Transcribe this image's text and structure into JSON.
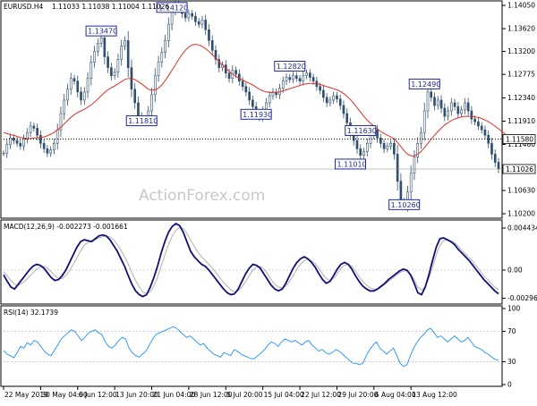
{
  "header": {
    "symbol": "EURUSD.H4",
    "ohlc": "1.11033 1.11038 1.11004 1.11026"
  },
  "watermark": "ActionForex.com",
  "chart_data": [
    {
      "type": "line",
      "pane": "price",
      "series_kind": "candlestick",
      "y_ticks": [
        "1.14050",
        "1.13620",
        "1.13200",
        "1.12775",
        "1.12340",
        "1.11910",
        "1.11480",
        "1.11050",
        "1.10630",
        "1.10200"
      ],
      "y_tick_values": [
        1.1405,
        1.1362,
        1.132,
        1.12775,
        1.1234,
        1.1191,
        1.1148,
        1.1105,
        1.1063,
        1.102
      ],
      "ylim": [
        1.1015,
        1.141
      ],
      "colors": {
        "candles": "#2f4f6f",
        "ma": "#e0302a",
        "dotted": "#000000"
      },
      "close_series": [
        1.1132,
        1.1148,
        1.116,
        1.1155,
        1.115,
        1.1145,
        1.1158,
        1.117,
        1.1182,
        1.1178,
        1.1165,
        1.115,
        1.114,
        1.1132,
        1.1138,
        1.115,
        1.1175,
        1.1205,
        1.123,
        1.125,
        1.127,
        1.1265,
        1.1245,
        1.123,
        1.1245,
        1.127,
        1.13,
        1.132,
        1.1335,
        1.1345,
        1.131,
        1.129,
        1.1275,
        1.1282,
        1.1305,
        1.133,
        1.134,
        1.129,
        1.125,
        1.1225,
        1.12,
        1.119,
        1.1195,
        1.121,
        1.124,
        1.1275,
        1.13,
        1.1318,
        1.134,
        1.137,
        1.1395,
        1.1408,
        1.1402,
        1.139,
        1.1382,
        1.139,
        1.1385,
        1.1375,
        1.137,
        1.1378,
        1.136,
        1.134,
        1.1322,
        1.1305,
        1.129,
        1.1295,
        1.128,
        1.127,
        1.1285,
        1.1278,
        1.1265,
        1.1255,
        1.1245,
        1.123,
        1.1218,
        1.1205,
        1.1198,
        1.121,
        1.1225,
        1.1238,
        1.1245,
        1.124,
        1.1252,
        1.1265,
        1.1272,
        1.1268,
        1.1275,
        1.127,
        1.1265,
        1.1275,
        1.128,
        1.1272,
        1.1265,
        1.1255,
        1.1248,
        1.1235,
        1.1225,
        1.123,
        1.1238,
        1.1232,
        1.122,
        1.1205,
        1.1188,
        1.117,
        1.1155,
        1.114,
        1.1128,
        1.1135,
        1.115,
        1.1165,
        1.1175,
        1.116,
        1.115,
        1.114,
        1.1145,
        1.115,
        1.113,
        1.108,
        1.1042,
        1.1035,
        1.106,
        1.1095,
        1.1125,
        1.115,
        1.117,
        1.121,
        1.1245,
        1.1235,
        1.122,
        1.123,
        1.1215,
        1.12,
        1.121,
        1.1225,
        1.1218,
        1.1205,
        1.1212,
        1.1225,
        1.121,
        1.1195,
        1.119,
        1.1182,
        1.1175,
        1.1165,
        1.115,
        1.113,
        1.1115,
        1.1103
      ],
      "ma_series": [
        1.117,
        1.1168,
        1.1166,
        1.1165,
        1.1163,
        1.1161,
        1.116,
        1.1159,
        1.1159,
        1.116,
        1.1161,
        1.1161,
        1.1162,
        1.1164,
        1.1167,
        1.117,
        1.1175,
        1.118,
        1.1186,
        1.1192,
        1.1198,
        1.1203,
        1.1207,
        1.121,
        1.1213,
        1.1217,
        1.1221,
        1.1226,
        1.1232,
        1.1238,
        1.1244,
        1.1249,
        1.1253,
        1.1256,
        1.126,
        1.1264,
        1.1268,
        1.127,
        1.127,
        1.1268,
        1.1264,
        1.126,
        1.1255,
        1.125,
        1.1248,
        1.1249,
        1.1252,
        1.1258,
        1.1266,
        1.1275,
        1.1285,
        1.1295,
        1.1305,
        1.1314,
        1.1322,
        1.1328,
        1.1332,
        1.1333,
        1.1332,
        1.1329,
        1.1325,
        1.132,
        1.1314,
        1.1308,
        1.1301,
        1.1295,
        1.1289,
        1.1283,
        1.1278,
        1.1274,
        1.127,
        1.1267,
        1.1264,
        1.1261,
        1.1258,
        1.1254,
        1.125,
        1.1247,
        1.1245,
        1.1244,
        1.1244,
        1.1244,
        1.1245,
        1.1247,
        1.1249,
        1.1251,
        1.1253,
        1.1255,
        1.1257,
        1.1259,
        1.126,
        1.1261,
        1.1261,
        1.126,
        1.1259,
        1.1257,
        1.1255,
        1.1253,
        1.1251,
        1.1249,
        1.1246,
        1.1242,
        1.1237,
        1.1231,
        1.1224,
        1.1216,
        1.1208,
        1.12,
        1.1193,
        1.1187,
        1.1182,
        1.1177,
        1.1172,
        1.1168,
        1.1165,
        1.1162,
        1.1158,
        1.1152,
        1.1144,
        1.1136,
        1.113,
        1.1127,
        1.1127,
        1.113,
        1.1135,
        1.1142,
        1.115,
        1.1158,
        1.1165,
        1.1172,
        1.1178,
        1.1184,
        1.1188,
        1.1192,
        1.1195,
        1.1197,
        1.1199,
        1.12,
        1.12,
        1.12,
        1.1199,
        1.1198,
        1.1196,
        1.1193,
        1.119,
        1.1186,
        1.1182,
        1.1177,
        1.1172,
        1.1167
      ],
      "dotted_level": 1.1158,
      "current_price": 1.11026,
      "axis_tags": [
        {
          "label": "1.11580",
          "value": 1.1158,
          "bg": "#ffffff",
          "fg": "#000000"
        },
        {
          "label": "1.11026",
          "value": 1.11026,
          "bg": "#ffffff",
          "fg": "#000000"
        }
      ],
      "annotations": [
        {
          "label": "1.13470",
          "index": 29,
          "value": 1.1347
        },
        {
          "label": "1.14120",
          "index": 50,
          "value": 1.1412
        },
        {
          "label": "1.11810",
          "index": 41,
          "value": 1.1181
        },
        {
          "label": "1.11930",
          "index": 75,
          "value": 1.1193
        },
        {
          "label": "1.12820",
          "index": 85,
          "value": 1.1282
        },
        {
          "label": "1.11630",
          "index": 106,
          "value": 1.1163
        },
        {
          "label": "1.11010",
          "index": 103,
          "value": 1.1101
        },
        {
          "label": "1.10260",
          "index": 119,
          "value": 1.1026
        },
        {
          "label": "1.12490",
          "index": 125,
          "value": 1.1249
        }
      ]
    },
    {
      "type": "line",
      "pane": "macd",
      "title": "MACD(12,26,9) -0.002273 -0.001661",
      "y_ticks": [
        "0.004434",
        "0.00",
        "-0.002969"
      ],
      "y_tick_values": [
        0.004434,
        0.0,
        -0.002969
      ],
      "ylim": [
        -0.0034,
        0.005
      ],
      "colors": {
        "macd": "#10107a",
        "signal": "#b0b0b0"
      },
      "macd_series": [
        -0.0005,
        -0.0012,
        -0.0018,
        -0.002,
        -0.0015,
        -0.001,
        -0.0005,
        0.0,
        0.0004,
        0.0006,
        0.0005,
        0.0002,
        -0.0003,
        -0.0008,
        -0.0011,
        -0.001,
        -0.0006,
        0.0,
        0.0008,
        0.0016,
        0.0024,
        0.003,
        0.0032,
        0.0031,
        0.003,
        0.0033,
        0.0036,
        0.0037,
        0.0036,
        0.0032,
        0.0026,
        0.002,
        0.0012,
        0.0004,
        -0.0006,
        -0.0015,
        -0.0022,
        -0.0026,
        -0.0028,
        -0.0026,
        -0.0018,
        -0.0008,
        0.0004,
        0.0018,
        0.003,
        0.004,
        0.0046,
        0.0049,
        0.0047,
        0.004,
        0.003,
        0.002,
        0.0014,
        0.001,
        0.0006,
        0.0004,
        0.0,
        -0.0005,
        -0.001,
        -0.0015,
        -0.002,
        -0.0024,
        -0.0026,
        -0.0025,
        -0.002,
        -0.0012,
        -0.0004,
        0.0002,
        0.0006,
        0.0005,
        0.0002,
        -0.0004,
        -0.001,
        -0.0016,
        -0.002,
        -0.0022,
        -0.002,
        -0.0014,
        -0.0006,
        0.0002,
        0.0008,
        0.0012,
        0.0014,
        0.0012,
        0.0008,
        0.0003,
        -0.0004,
        -0.001,
        -0.0014,
        -0.0012,
        -0.0006,
        0.0001,
        0.0006,
        0.0008,
        0.0006,
        0.0001,
        -0.0006,
        -0.0012,
        -0.0017,
        -0.002,
        -0.0022,
        -0.0022,
        -0.002,
        -0.0017,
        -0.0014,
        -0.001,
        -0.0007,
        -0.0004,
        -0.0001,
        0.0001,
        0.0,
        -0.0005,
        -0.0014,
        -0.0024,
        -0.0026,
        -0.0018,
        -0.0005,
        0.001,
        0.0024,
        0.0033,
        0.0034,
        0.0032,
        0.003,
        0.0027,
        0.0022,
        0.0018,
        0.0014,
        0.001,
        0.0005,
        0.0,
        -0.0005,
        -0.001,
        -0.0014,
        -0.0018,
        -0.0022,
        -0.0025
      ],
      "signal_series": [
        -0.0002,
        -0.0006,
        -0.0011,
        -0.0015,
        -0.0016,
        -0.0014,
        -0.0011,
        -0.0007,
        -0.0003,
        0.0001,
        0.0003,
        0.0004,
        0.0002,
        -0.0002,
        -0.0006,
        -0.0009,
        -0.0009,
        -0.0006,
        -0.0001,
        0.0006,
        0.0013,
        0.002,
        0.0026,
        0.0029,
        0.0031,
        0.0032,
        0.0034,
        0.0035,
        0.0036,
        0.0035,
        0.0032,
        0.0027,
        0.0021,
        0.0014,
        0.0006,
        -0.0003,
        -0.0011,
        -0.0018,
        -0.0023,
        -0.0025,
        -0.0023,
        -0.0017,
        -0.0008,
        0.0004,
        0.0016,
        0.0027,
        0.0036,
        0.0042,
        0.0045,
        0.0044,
        0.0039,
        0.0032,
        0.0025,
        0.0019,
        0.0014,
        0.001,
        0.0006,
        0.0002,
        -0.0003,
        -0.0008,
        -0.0013,
        -0.0017,
        -0.0021,
        -0.0023,
        -0.0022,
        -0.0018,
        -0.0012,
        -0.0006,
        0.0,
        0.0003,
        0.0004,
        0.0001,
        -0.0004,
        -0.001,
        -0.0015,
        -0.0018,
        -0.0019,
        -0.0017,
        -0.0012,
        -0.0006,
        0.0001,
        0.0006,
        0.001,
        0.0011,
        0.001,
        0.0007,
        0.0002,
        -0.0004,
        -0.0009,
        -0.0011,
        -0.0009,
        -0.0004,
        0.0002,
        0.0005,
        0.0006,
        0.0004,
        -0.0001,
        -0.0007,
        -0.0012,
        -0.0016,
        -0.0019,
        -0.002,
        -0.002,
        -0.0018,
        -0.0015,
        -0.0012,
        -0.0009,
        -0.0006,
        -0.0003,
        -0.0001,
        -0.0001,
        -0.0004,
        -0.001,
        -0.0018,
        -0.0021,
        -0.0018,
        -0.0009,
        0.0003,
        0.0016,
        0.0026,
        0.0031,
        0.0032,
        0.0031,
        0.0029,
        0.0025,
        0.0021,
        0.0017,
        0.0013,
        0.0009,
        0.0004,
        -0.0001,
        -0.0006,
        -0.001,
        -0.0014,
        -0.0018,
        -0.0021
      ]
    },
    {
      "type": "line",
      "pane": "rsi",
      "title": "RSI(14) 32.1739",
      "y_ticks": [
        "100",
        "70",
        "30",
        "0"
      ],
      "y_tick_values": [
        100,
        70,
        30,
        0
      ],
      "ylim": [
        0,
        100
      ],
      "levels": [
        70,
        30
      ],
      "colors": {
        "rsi": "#1e90ff",
        "levels": "#999999"
      },
      "rsi_series": [
        45,
        40,
        38,
        35,
        42,
        50,
        48,
        55,
        52,
        58,
        56,
        50,
        44,
        40,
        38,
        45,
        52,
        60,
        64,
        68,
        72,
        70,
        64,
        58,
        62,
        68,
        70,
        72,
        68,
        66,
        56,
        50,
        48,
        52,
        58,
        62,
        60,
        48,
        42,
        38,
        36,
        40,
        44,
        52,
        60,
        66,
        68,
        70,
        72,
        74,
        76,
        74,
        70,
        66,
        62,
        64,
        60,
        56,
        52,
        54,
        48,
        44,
        40,
        38,
        36,
        42,
        40,
        38,
        46,
        44,
        40,
        38,
        36,
        34,
        34,
        38,
        42,
        46,
        52,
        56,
        54,
        50,
        56,
        60,
        58,
        56,
        58,
        55,
        52,
        56,
        58,
        52,
        48,
        44,
        46,
        42,
        40,
        42,
        46,
        44,
        40,
        36,
        32,
        28,
        28,
        26,
        28,
        38,
        46,
        52,
        56,
        48,
        44,
        40,
        44,
        48,
        38,
        28,
        24,
        26,
        38,
        48,
        56,
        62,
        66,
        72,
        74,
        68,
        62,
        64,
        60,
        56,
        60,
        64,
        60,
        56,
        58,
        62,
        56,
        50,
        48,
        46,
        42,
        40,
        36,
        33,
        32
      ]
    },
    {
      "type": "line",
      "pane": "x-axis",
      "x_ticks": [
        "22 May 2019",
        "30 May 04:00",
        "6 Jun 12:00",
        "13 Jun 20:00",
        "21 Jun 04:00",
        "28 Jun 12:00",
        "5 Jul 20:00",
        "15 Jul 04:00",
        "22 Jul 12:00",
        "29 Jul 20:00",
        "6 Aug 04:00",
        "13 Aug 12:00"
      ],
      "x_tick_index": [
        0,
        11,
        22,
        33,
        44,
        55,
        66,
        77,
        88,
        99,
        110,
        121
      ]
    }
  ]
}
